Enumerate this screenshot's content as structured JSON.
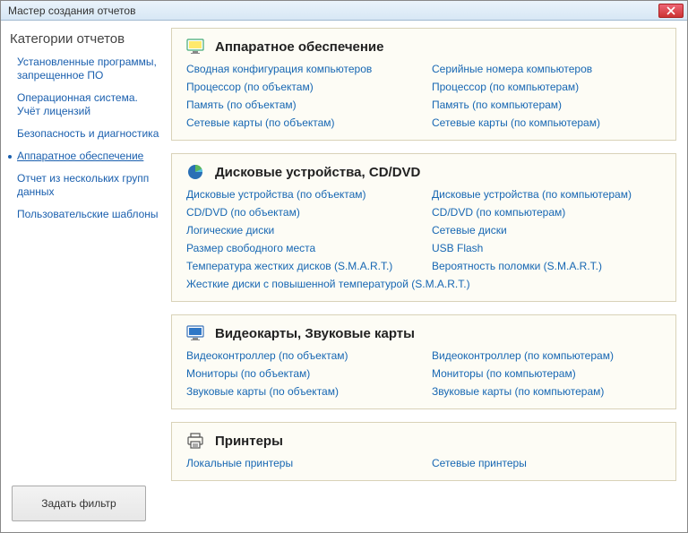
{
  "window": {
    "title": "Мастер создания отчетов"
  },
  "sidebar": {
    "heading": "Категории отчетов",
    "items": [
      "Установленные программы, запрещенное ПО",
      "Операционная система. Учёт лицензий",
      "Безопасность и диагностика",
      "Аппаратное обеспечение",
      "Отчет из нескольких групп данных",
      "Пользовательские шаблоны"
    ],
    "active_index": 3,
    "filter_button": "Задать фильтр"
  },
  "sections": [
    {
      "icon": "monitor-yellow",
      "title": "Аппаратное обеспечение",
      "links_left": [
        "Сводная конфигурация компьютеров",
        "Процессор (по объектам)",
        "Память (по объектам)",
        "Сетевые карты (по объектам)"
      ],
      "links_right": [
        "Серийные номера компьютеров",
        "Процессор (по компьютерам)",
        "Память (по компьютерам)",
        "Сетевые карты (по компьютерам)"
      ]
    },
    {
      "icon": "pie-chart",
      "title": "Дисковые устройства, CD/DVD",
      "links_left": [
        "Дисковые устройства (по объектам)",
        "CD/DVD (по объектам)",
        "Логические диски",
        "Размер свободного места",
        "Температура жестких дисков (S.M.A.R.T.)"
      ],
      "links_right": [
        "Дисковые устройства (по компьютерам)",
        "CD/DVD (по компьютерам)",
        "Сетевые диски",
        "USB Flash",
        "Вероятность поломки (S.M.A.R.T.)"
      ],
      "links_full": [
        "Жесткие диски с повышенной температурой (S.M.A.R.T.)"
      ]
    },
    {
      "icon": "monitor-blue",
      "title": "Видеокарты, Звуковые карты",
      "links_left": [
        "Видеоконтроллер (по объектам)",
        "Мониторы (по объектам)",
        "Звуковые карты (по объектам)"
      ],
      "links_right": [
        "Видеоконтроллер (по компьютерам)",
        "Мониторы (по компьютерам)",
        "Звуковые карты (по компьютерам)"
      ]
    },
    {
      "icon": "printer",
      "title": "Принтеры",
      "links_left": [
        "Локальные принтеры"
      ],
      "links_right": [
        "Сетевые принтеры"
      ]
    }
  ]
}
